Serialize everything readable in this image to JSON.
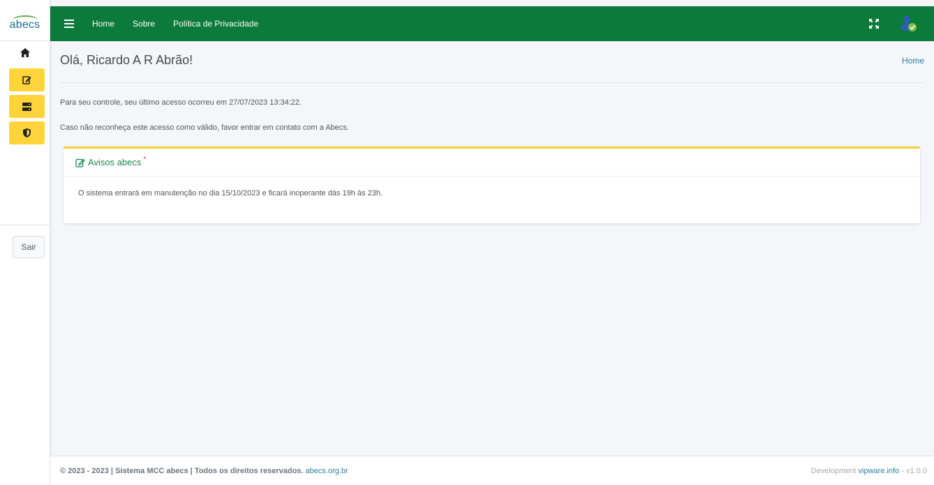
{
  "brand": {
    "logo_text": "abecs"
  },
  "colors": {
    "topbar": "#0b7a3b",
    "sidebar_button": "#ffd43b",
    "card_accent": "#f2d13a",
    "link": "#2f7ea3",
    "card_title": "#198754"
  },
  "sidebar": {
    "items": [
      {
        "icon": "home-icon"
      },
      {
        "icon": "edit-icon"
      },
      {
        "icon": "server-icon"
      },
      {
        "icon": "shield-icon"
      }
    ],
    "logout_label": "Sair"
  },
  "topbar": {
    "links": [
      "Home",
      "Sobre",
      "Política de Privacidade"
    ],
    "icons": [
      "menu-icon",
      "expand-icon",
      "user-avatar"
    ]
  },
  "main": {
    "greeting": "Olá, Ricardo A R Abrão!",
    "breadcrumb": "Home",
    "last_access": "Para seu controle, seu último acesso ocorreu em 27/07/2023 13:34:22.",
    "warning": "Caso não reconheça este acesso como válido, favor entrar em contato com a Abecs.",
    "notices": {
      "title": "Avisos abecs",
      "required_mark": "*",
      "body": "O sistema entrará em manutenção no dia 15/10/2023 e ficará inoperante dàs 19h às 23h."
    }
  },
  "footer": {
    "copyright": "© 2023 - 2023 | Sistema MCC abecs | Todos os direitos reservados.",
    "site_link": "abecs.org.br",
    "dev_label": "Development",
    "dev_link": "vipware.info",
    "version": "- v1.0.0"
  }
}
